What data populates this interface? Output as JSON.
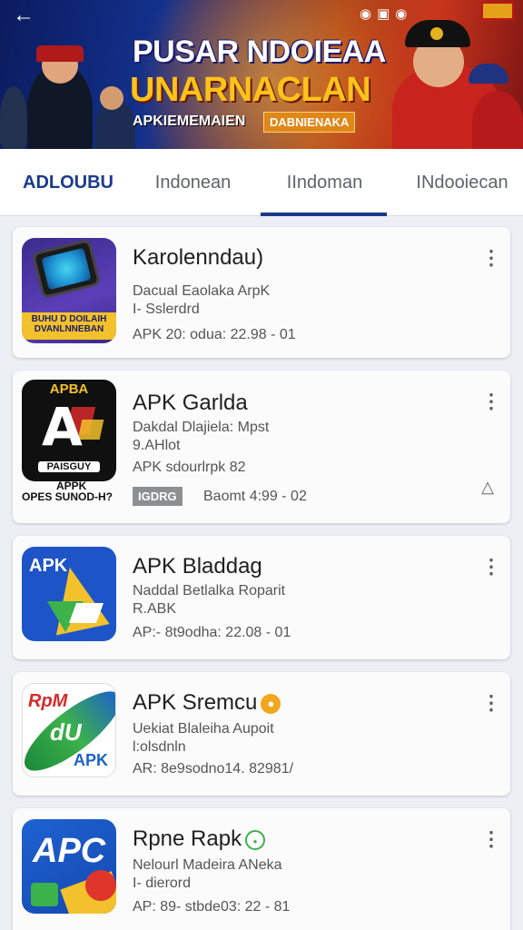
{
  "banner": {
    "title_line1": "PUSAR NDOIEAA",
    "title_line2": "UNARNACLAN",
    "subtitle": "APKIEMEMAIEN",
    "tag": "DABNIENAKA"
  },
  "tabs": [
    {
      "label": "ADLOUBU"
    },
    {
      "label": "Indonean"
    },
    {
      "label": "IIndoman"
    },
    {
      "label": "INdooiecan"
    }
  ],
  "apps": [
    {
      "title": "Karolenndau)",
      "line1": "Dacual Eaolaka ArpK",
      "line2": "I- Sslerdrd",
      "meta": "APK 20: odua: 22.98 - 01",
      "icon_text": "BUHU D DOILAIH DVANLNNEBAN"
    },
    {
      "title": "APK Garlda",
      "line1": "Dakdal Dlajiela: Mpst",
      "line2": "9.AHlot",
      "meta": "APK sdourlrpk  82",
      "chip": "IGDRG",
      "meta2": "Baomt 4:99 - 02",
      "icon_top": "APBA",
      "icon_letter": "A",
      "icon_bottom": "PAISGUY",
      "icon_caption1": "APPK",
      "icon_caption2": "OPES SUNOD-H?"
    },
    {
      "title": "APK Bladdag",
      "line1": "Naddal Betlalka Roparit",
      "line2": "R.ABK",
      "meta": "AP:- 8t9odha: 22.08 - 01",
      "icon_text": "APK"
    },
    {
      "title": "APK Sremcu",
      "line1": "Uekiat Blaleiha Aupoit",
      "line2": "l:olsdnln",
      "meta": "AR: 8e9sodno14. 82981/",
      "icon_top": "RpM",
      "icon_mid": "dU",
      "icon_bottom": "APK"
    },
    {
      "title": "Rpne Rapk",
      "line1": "Nelourl Madeira ANeka",
      "line2": "I- dierord",
      "meta": "AP: 89- stbde03: 22 - 81",
      "icon_text": "APC"
    }
  ]
}
